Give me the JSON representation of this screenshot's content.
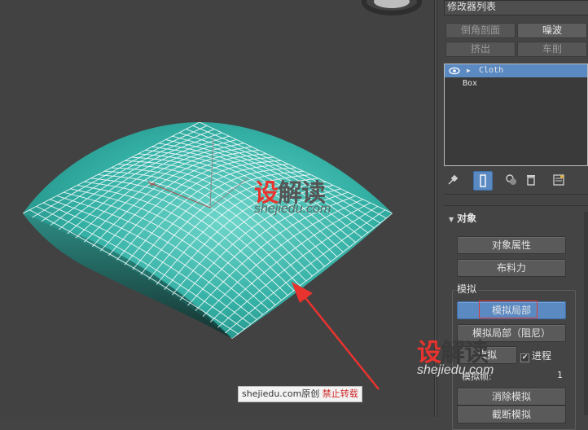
{
  "watermarks": {
    "brand_red": "设",
    "brand_gray": "解读",
    "site": "shejiedu.com"
  },
  "source_label": {
    "site": "shejiedu.com",
    "original": "原创",
    "warning": "禁止转载"
  },
  "panel": {
    "modifier_list": "修改器列表",
    "modifier_buttons": [
      "倒角剖面",
      "噪波",
      "挤出",
      "车削"
    ],
    "stack": [
      {
        "name": "Cloth",
        "selected": true
      },
      {
        "name": "Box",
        "selected": false
      }
    ],
    "toolbar_icons": [
      "pin-stack-icon",
      "show-end-result-icon",
      "make-unique-icon",
      "remove-modifier-icon",
      "configure-modifier-sets-icon"
    ],
    "rollout_title": "对象",
    "buttons": {
      "object_properties": "对象属性",
      "cloth_forces": "布料力"
    },
    "simulation_group": {
      "label": "模拟",
      "local": "模拟局部",
      "local_damped": "模拟局部（阻尼）",
      "simulate_partial": "模拟",
      "progress_label": "进程",
      "progress_checked": true,
      "frames_label": "模拟帧:",
      "frames_value": "1",
      "erase": "消除模拟",
      "truncate": "截断模拟"
    }
  },
  "colors": {
    "cloth": "#3fb8ad",
    "selection_blue": "#5b8ac3",
    "annotation_red": "#e8332e"
  }
}
